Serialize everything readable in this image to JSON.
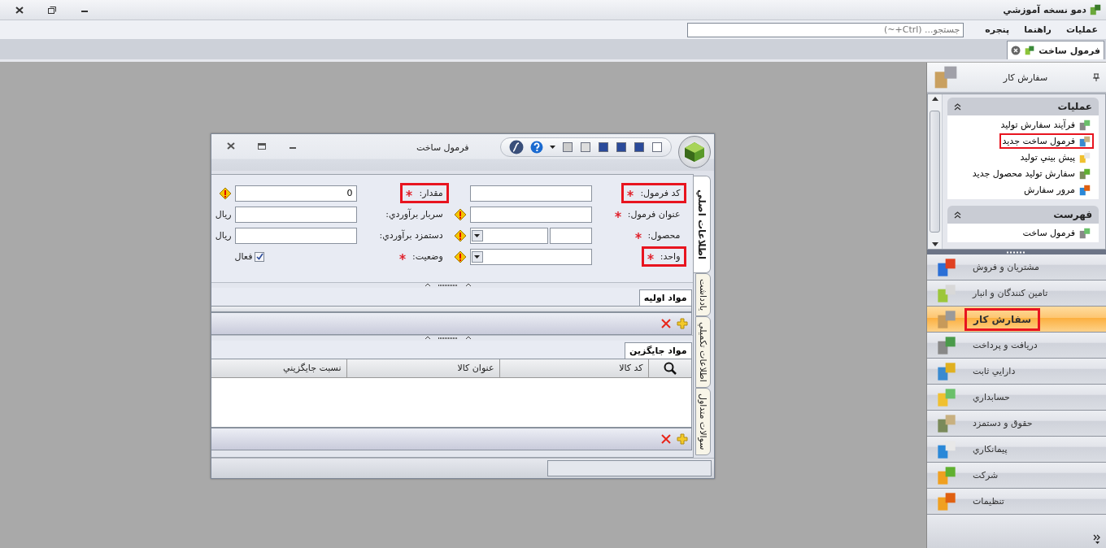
{
  "app": {
    "title": "دمو نسخه آموزشي"
  },
  "menu": [
    {
      "label": "عمليات"
    },
    {
      "label": "راهنما"
    },
    {
      "label": "پنجره"
    }
  ],
  "search": {
    "placeholder": "جستجو... (Ctrl+~)"
  },
  "document_tabs": [
    {
      "label": "فرمول ساخت",
      "selected": true
    }
  ],
  "sidebar": {
    "title": "سفارش کار",
    "groups": [
      {
        "title": "عمليات",
        "expanded": true,
        "items": [
          {
            "label": "فرآيند سفارش توليد",
            "highlighted": false
          },
          {
            "label": "فرمول ساخت جديد",
            "highlighted": true
          },
          {
            "label": "پيش بيني توليد",
            "highlighted": false
          },
          {
            "label": "سفارش توليد محصول جديد",
            "highlighted": false
          },
          {
            "label": "مرور سفارش",
            "highlighted": false
          }
        ]
      },
      {
        "title": "فهرست",
        "expanded": true,
        "items": [
          {
            "label": "فرمول ساخت",
            "highlighted": false
          }
        ]
      }
    ],
    "nav": [
      {
        "label": "مشتريان و فروش",
        "selected": false,
        "highlighted": false
      },
      {
        "label": "تامين کنندگان و انبار",
        "selected": false,
        "highlighted": false
      },
      {
        "label": "سفارش کار",
        "selected": true,
        "highlighted": true
      },
      {
        "label": "دريافت و پرداخت",
        "selected": false,
        "highlighted": false
      },
      {
        "label": "دارايي ثابت",
        "selected": false,
        "highlighted": false
      },
      {
        "label": "حسابداري",
        "selected": false,
        "highlighted": false
      },
      {
        "label": "حقوق و دستمزد",
        "selected": false,
        "highlighted": false
      },
      {
        "label": "پيمانکاري",
        "selected": false,
        "highlighted": false
      },
      {
        "label": "شرکت",
        "selected": false,
        "highlighted": false
      },
      {
        "label": "تنظيمات",
        "selected": false,
        "highlighted": false
      }
    ]
  },
  "form_window": {
    "title": "فرمول ساخت",
    "side_tabs": [
      {
        "label": "اطلاعات اصلي",
        "selected": true
      },
      {
        "label": "يادداشت",
        "selected": false
      },
      {
        "label": "اطلاعات تکميلي",
        "selected": false
      },
      {
        "label": "سوالات متداول",
        "selected": false
      }
    ],
    "rows": [
      [
        {
          "label": "کد فرمول:",
          "required": true,
          "highlighted": true,
          "kind": "text",
          "warning": false
        },
        {
          "label": "مقدار:",
          "required": true,
          "highlighted": true,
          "kind": "text",
          "value": "0",
          "warning": true
        }
      ],
      [
        {
          "label": "عنوان فرمول:",
          "required": true,
          "highlighted": false,
          "kind": "text",
          "warning": true
        },
        {
          "label": "سربار برآوردي:",
          "required": false,
          "highlighted": false,
          "kind": "text",
          "unit": "ريال",
          "warning": false
        }
      ],
      [
        {
          "label": "محصول:",
          "required": true,
          "highlighted": false,
          "kind": "code-combo",
          "warning": true
        },
        {
          "label": "دستمزد برآوردي:",
          "required": false,
          "highlighted": false,
          "kind": "text",
          "unit": "ريال",
          "warning": false
        }
      ],
      [
        {
          "label": "واحد:",
          "required": true,
          "highlighted": true,
          "kind": "combo",
          "warning": true
        },
        {
          "label": "وضعيت:",
          "required": true,
          "highlighted": false,
          "kind": "checkbox",
          "checked": true,
          "caption": "فعال",
          "warning": false
        }
      ]
    ],
    "primary_grid": {
      "tab": "مواد اوليه"
    },
    "substitute_grid": {
      "tab": "مواد جايگزين",
      "columns": [
        "کد کالا",
        "عنوان کالا",
        "نسبت جايگزيني"
      ]
    }
  }
}
